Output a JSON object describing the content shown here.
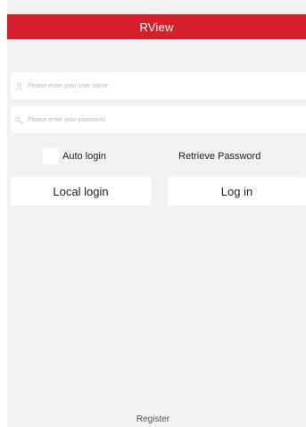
{
  "header": {
    "title": "RView"
  },
  "login_form": {
    "username_placeholder": "Please enter your user name",
    "password_placeholder": "Please enter your password",
    "auto_login_label": "Auto login",
    "retrieve_password_label": "Retrieve Password",
    "local_login_label": "Local login",
    "login_label": "Log in"
  },
  "footer": {
    "register_label": "Register"
  },
  "colors": {
    "accent": "#d8202c",
    "background": "#f2f2f2",
    "field_background": "#ffffff"
  },
  "icons": {
    "username": "user-icon",
    "password": "key-icon"
  }
}
